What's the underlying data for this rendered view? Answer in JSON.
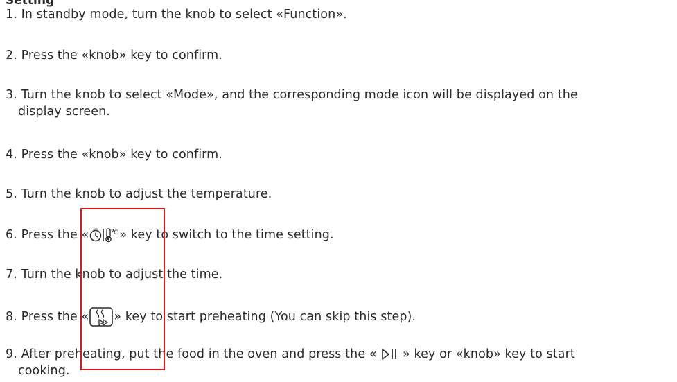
{
  "heading_partial": "Setting",
  "steps": [
    {
      "num": "1.",
      "text": "In standby mode, turn the knob to select «Function»."
    },
    {
      "num": "2.",
      "text": "Press the «knob» key to confirm."
    },
    {
      "num": "3.",
      "text": "Turn the knob to select «Mode», and the corresponding mode icon will be displayed on the",
      "text_cont": "display screen."
    },
    {
      "num": "4.",
      "text": "Press the «knob» key to confirm."
    },
    {
      "num": "5.",
      "text": "Turn the knob to adjust the temperature."
    },
    {
      "num": "6.",
      "pre": "Press the «",
      "post": "» key to switch to the time setting.",
      "icon": "timer-temperature-icon"
    },
    {
      "num": "7.",
      "text": "Turn the knob to adjust the time."
    },
    {
      "num": "8.",
      "pre": "Press the «",
      "post": "» key to start preheating (You can skip this step).",
      "icon": "preheat-icon"
    },
    {
      "num": "9.",
      "pre": "After preheating, put the food in the oven and press the « ",
      "post": " » key or «knob» key to start",
      "text_cont": "cooking.",
      "icon": "play-pause-icon"
    }
  ],
  "colors": {
    "text": "#2b2b2b",
    "highlight": "#e0161b"
  }
}
